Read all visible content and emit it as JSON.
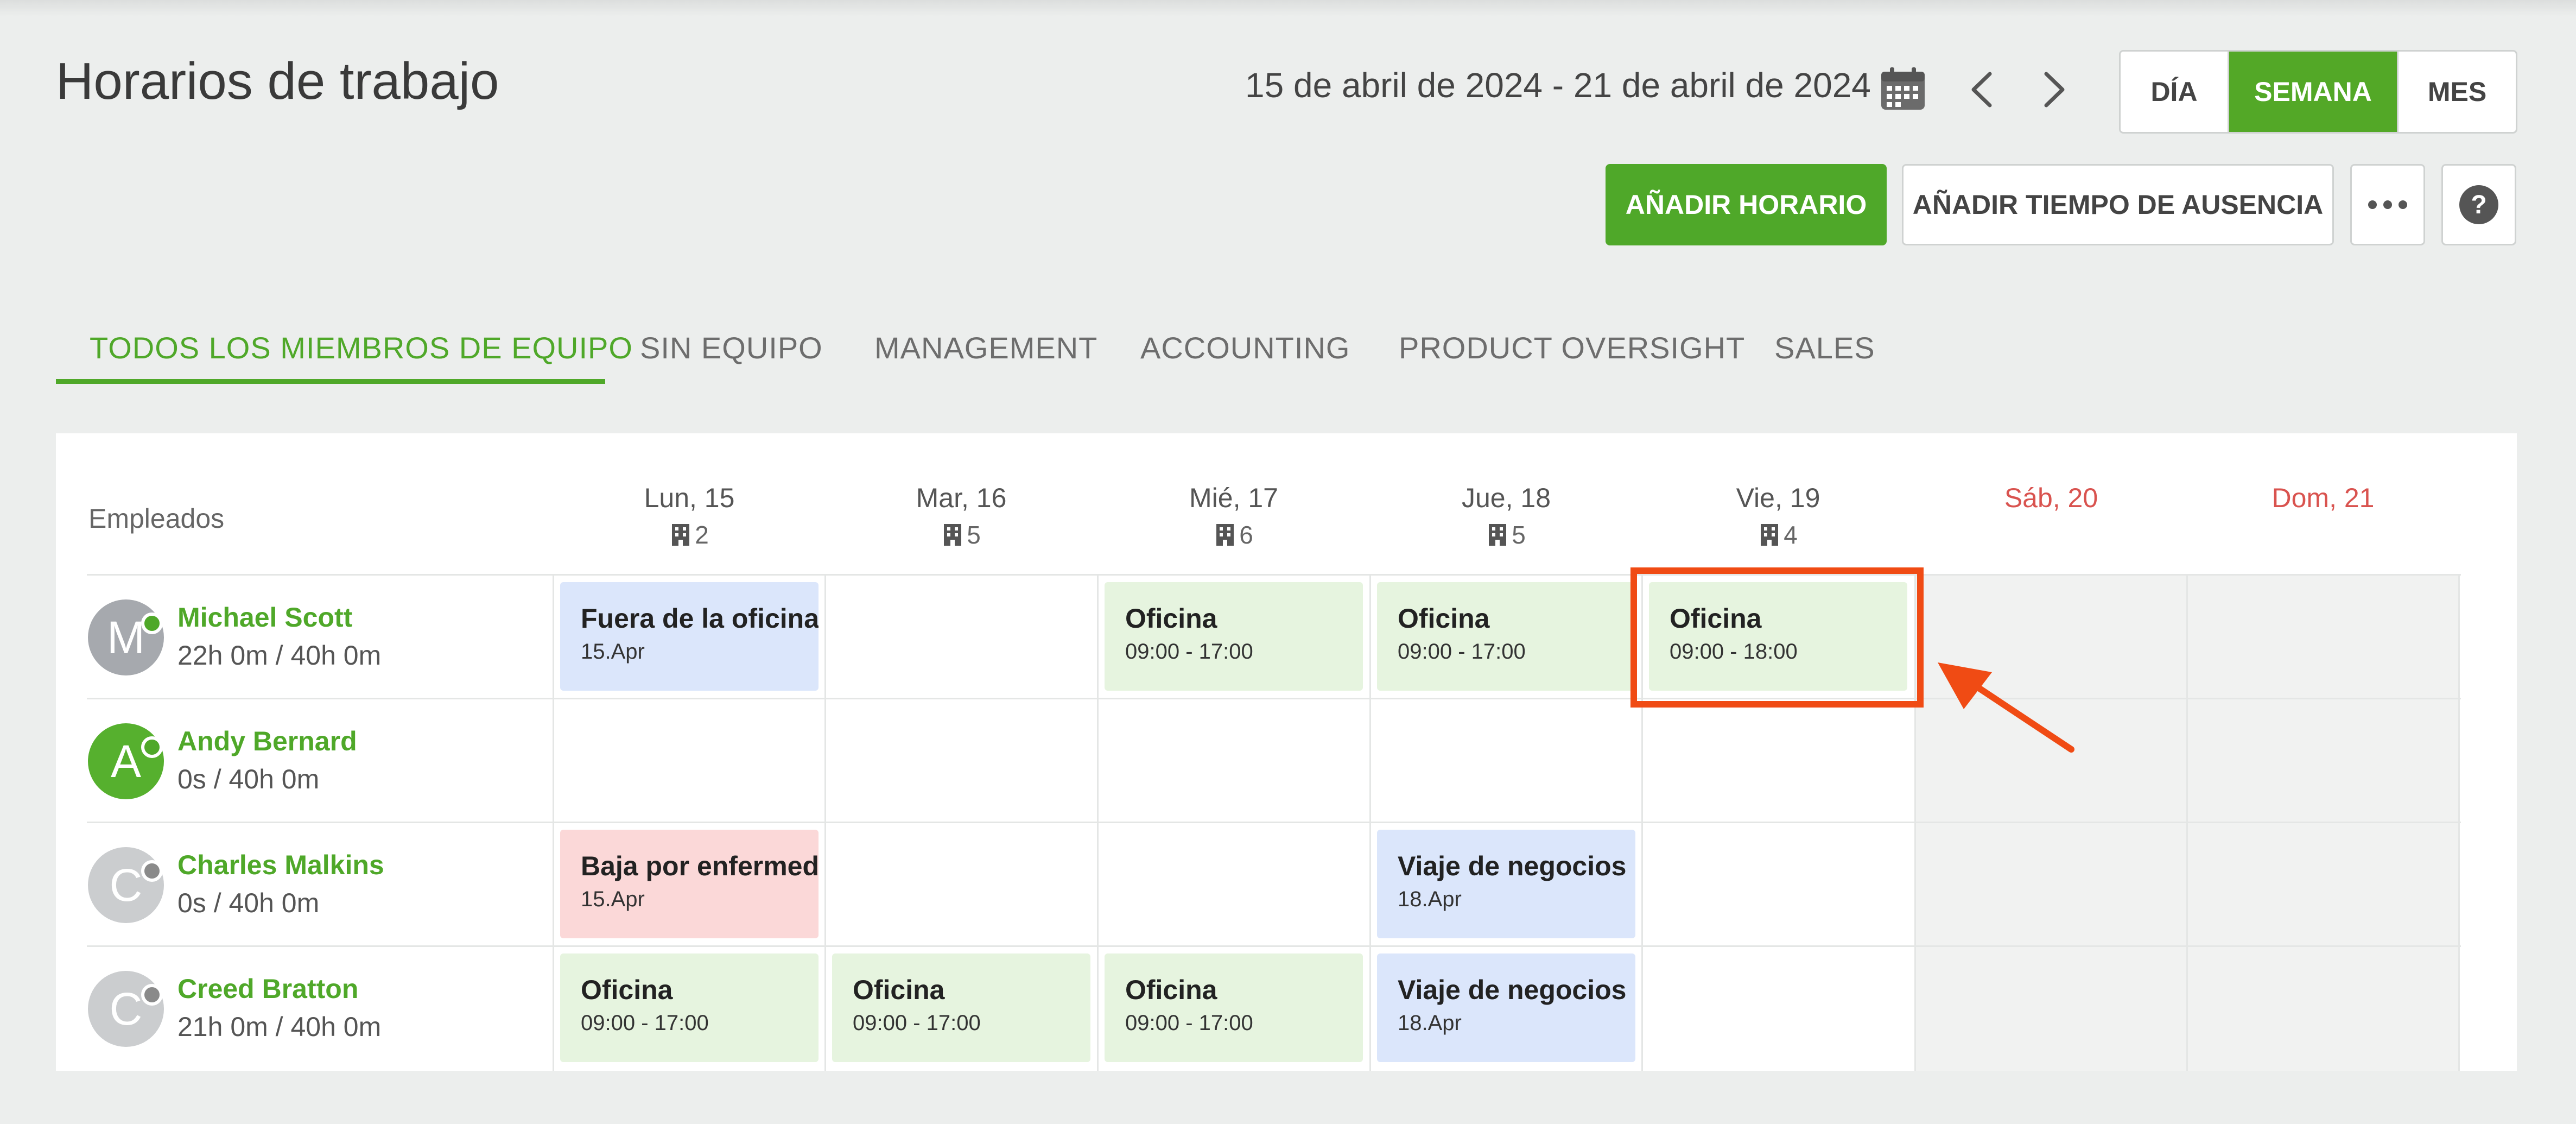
{
  "header": {
    "title": "Horarios de trabajo",
    "date_range": "15 de abril de 2024 - 21 de abril de 2024",
    "view_options": [
      "DÍA",
      "SEMANA",
      "MES"
    ],
    "active_view": "SEMANA"
  },
  "actions": {
    "add_schedule": "AÑADIR HORARIO",
    "add_time_off": "AÑADIR TIEMPO DE AUSENCIA"
  },
  "tabs": [
    "TODOS LOS MIEMBROS DE EQUIPO",
    "SIN EQUIPO",
    "MANAGEMENT",
    "ACCOUNTING",
    "PRODUCT OVERSIGHT",
    "SALES"
  ],
  "table": {
    "employees_header": "Empleados",
    "days": [
      {
        "label": "Lun, 15",
        "count": "2",
        "weekend": false
      },
      {
        "label": "Mar, 16",
        "count": "5",
        "weekend": false
      },
      {
        "label": "Mié, 17",
        "count": "6",
        "weekend": false
      },
      {
        "label": "Jue, 18",
        "count": "5",
        "weekend": false
      },
      {
        "label": "Vie, 19",
        "count": "4",
        "weekend": false
      },
      {
        "label": "Sáb, 20",
        "count": "",
        "weekend": true
      },
      {
        "label": "Dom, 21",
        "count": "",
        "weekend": true
      }
    ],
    "employees": [
      {
        "initial": "M",
        "name": "Michael Scott",
        "hours": "22h 0m / 40h 0m",
        "avatar_color": "#a6a9ae",
        "status_color": "#4fa829",
        "shifts": [
          {
            "day": 0,
            "title": "Fuera de la oficina",
            "sub": "15.Apr",
            "kind": "blue"
          },
          {
            "day": 2,
            "title": "Oficina",
            "sub": "09:00 - 17:00",
            "kind": "green"
          },
          {
            "day": 3,
            "title": "Oficina",
            "sub": "09:00 - 17:00",
            "kind": "green"
          },
          {
            "day": 4,
            "title": "Oficina",
            "sub": "09:00 - 18:00",
            "kind": "green"
          }
        ]
      },
      {
        "initial": "A",
        "name": "Andy Bernard",
        "hours": "0s / 40h 0m",
        "avatar_color": "#56b02e",
        "status_color": "#4fa829",
        "shifts": []
      },
      {
        "initial": "C",
        "name": "Charles Malkins",
        "hours": "0s / 40h 0m",
        "avatar_color": "#cbcdcf",
        "status_color": "#8a8a8a",
        "shifts": [
          {
            "day": 0,
            "title": "Baja por enfermedad",
            "sub": "15.Apr",
            "kind": "red"
          },
          {
            "day": 3,
            "title": "Viaje de negocios",
            "sub": "18.Apr",
            "kind": "blue"
          }
        ]
      },
      {
        "initial": "C",
        "name": "Creed Bratton",
        "hours": "21h 0m / 40h 0m",
        "avatar_color": "#cbcdcf",
        "status_color": "#8a8a8a",
        "shifts": [
          {
            "day": 0,
            "title": "Oficina",
            "sub": "09:00 - 17:00",
            "kind": "green"
          },
          {
            "day": 1,
            "title": "Oficina",
            "sub": "09:00 - 17:00",
            "kind": "green"
          },
          {
            "day": 2,
            "title": "Oficina",
            "sub": "09:00 - 17:00",
            "kind": "green"
          },
          {
            "day": 3,
            "title": "Viaje de negocios",
            "sub": "18.Apr",
            "kind": "blue"
          }
        ]
      }
    ]
  },
  "colors": {
    "accent": "#4fa829",
    "weekend_text": "#d9534f",
    "annotation": "#f04b14"
  },
  "icons": [
    "calendar-icon",
    "chevron-left-icon",
    "chevron-right-icon",
    "more-icon",
    "help-icon",
    "building-icon"
  ]
}
